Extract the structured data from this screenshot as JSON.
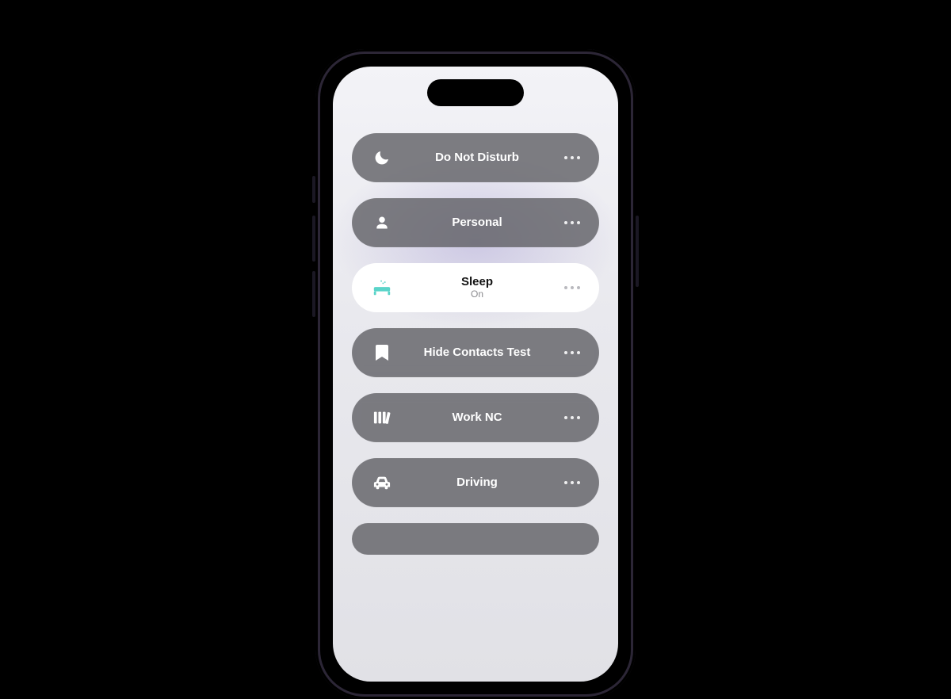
{
  "focus_modes": {
    "items": [
      {
        "id": "dnd",
        "icon": "moon",
        "label": "Do Not Disturb",
        "sub": "",
        "active": false
      },
      {
        "id": "personal",
        "icon": "person",
        "label": "Personal",
        "sub": "",
        "active": false
      },
      {
        "id": "sleep",
        "icon": "bed",
        "label": "Sleep",
        "sub": "On",
        "active": true
      },
      {
        "id": "hide",
        "icon": "bookmark",
        "label": "Hide Contacts Test",
        "sub": "",
        "active": false
      },
      {
        "id": "work",
        "icon": "books",
        "label": "Work NC",
        "sub": "",
        "active": false
      },
      {
        "id": "driving",
        "icon": "car",
        "label": "Driving",
        "sub": "",
        "active": false
      }
    ]
  },
  "colors": {
    "accent_teal": "#5ad4c9"
  }
}
